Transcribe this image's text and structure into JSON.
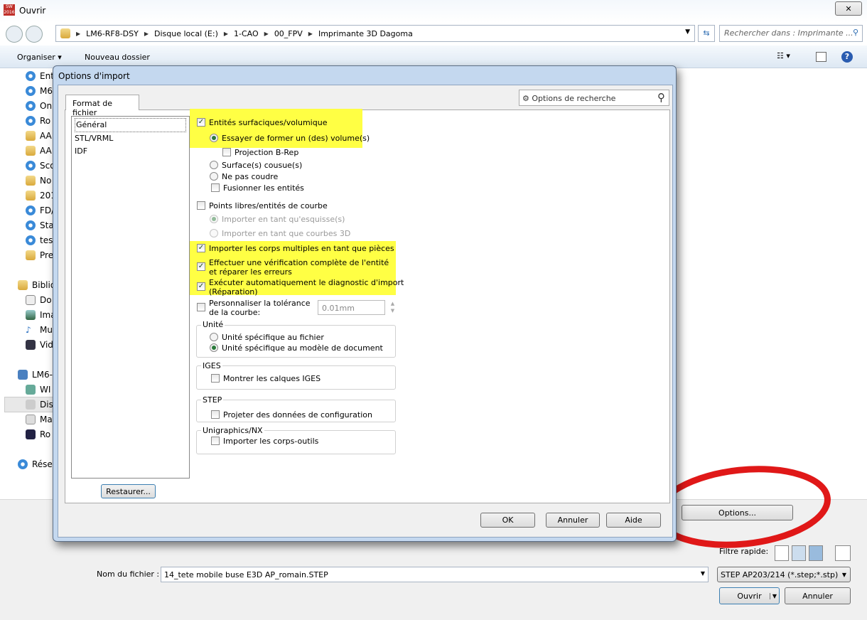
{
  "window": {
    "title": "Ouvrir",
    "app_badge": "SW 2016",
    "close": "✕"
  },
  "address": {
    "crumbs": [
      "LM6-RF8-DSY",
      "Disque local (E:)",
      "1-CAO",
      "00_FPV",
      "Imprimante 3D Dagoma"
    ],
    "search_placeholder": "Rechercher dans : Imprimante ..."
  },
  "toolbar": {
    "organize": "Organiser ▾",
    "new_folder": "Nouveau dossier"
  },
  "nav": {
    "favorites": [
      "Ent",
      "M6",
      "On",
      "Ro",
      "AA",
      "AA",
      "Sco",
      "No",
      "201",
      "FD/",
      "Sta",
      "tes",
      "Pre"
    ],
    "libraries": "Biblio",
    "lib_items": [
      "Do",
      "Ima",
      "Mu",
      "Vid"
    ],
    "computer": "LM6-",
    "comp_items": [
      "WI",
      "Dis",
      "Ma",
      "Ro"
    ],
    "network": "Rése"
  },
  "dialog": {
    "title": "Options d'import",
    "tab": "Format de fichier",
    "search": "Options de recherche",
    "formats": [
      "Général",
      "STL/VRML",
      "IDF"
    ],
    "restore": "Restaurer...",
    "opts": {
      "solid": {
        "label": "Entités surfaciques/volumique",
        "checked": true
      },
      "try_solid": "Essayer de former un (des) volume(s)",
      "brep": "Projection B-Rep",
      "knit": "Surface(s) cousue(s)",
      "noknit": "Ne pas coudre",
      "merge": "Fusionner les entités",
      "free_points": "Points libres/entités de courbe",
      "as_sketch": "Importer en tant qu'esquisse(s)",
      "as_3d": "Importer en tant que courbes 3D",
      "multi_body": "Importer les corps multiples en tant que pièces",
      "check1": "Effectuer une vérification complète de l'entité",
      "check2": "et réparer les erreurs",
      "diag1": "Exécuter automatiquement le diagnostic d'import",
      "diag2": "(Réparation)",
      "tol1": "Personnaliser la tolérance",
      "tol2": "de la courbe:",
      "tol_value": "0.01mm",
      "unit_group": "Unité",
      "unit_file": "Unité spécifique au fichier",
      "unit_doc": "Unité spécifique au modèle de document",
      "iges_group": "IGES",
      "iges_layers": "Montrer les calques IGES",
      "step_group": "STEP",
      "step_config": "Projeter des données de configuration",
      "nx_group": "Unigraphics/NX",
      "nx_tools": "Importer les corps-outils"
    },
    "ok": "OK",
    "cancel": "Annuler",
    "help": "Aide"
  },
  "bottom": {
    "options": "Options...",
    "quick_filter": "Filtre rapide:",
    "filename_label": "Nom du fichier :",
    "filename": "14_tete mobile buse E3D AP_romain.STEP",
    "filetype": "STEP AP203/214 (*.step;*.stp)",
    "open": "Ouvrir",
    "cancel": "Annuler"
  },
  "colors": {
    "highlight": "#ffff44",
    "annotation": "#e01818"
  }
}
